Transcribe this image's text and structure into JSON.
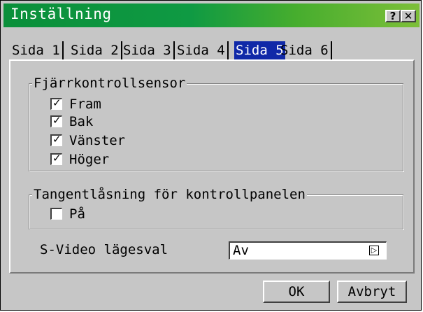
{
  "window": {
    "title": "Inställning",
    "help_label": "?",
    "close_label": "✕"
  },
  "tabs": [
    {
      "label": "Sida 1",
      "active": false
    },
    {
      "label": "Sida 2",
      "active": false
    },
    {
      "label": "Sida 3",
      "active": false
    },
    {
      "label": "Sida 4",
      "active": false
    },
    {
      "label": "Sida 5",
      "active": true
    },
    {
      "label": "Sida 6",
      "active": false
    }
  ],
  "remote_sensor": {
    "legend": "Fjärrkontrollsensor",
    "options": [
      {
        "label": "Fram",
        "checked": true
      },
      {
        "label": "Bak",
        "checked": true
      },
      {
        "label": "Vänster",
        "checked": true
      },
      {
        "label": "Höger",
        "checked": true
      }
    ]
  },
  "key_lock": {
    "legend": "Tangentlåsning för kontrollpanelen",
    "option": {
      "label": "På",
      "checked": false
    }
  },
  "svideo": {
    "label": "S-Video lägesval",
    "value": "Av"
  },
  "buttons": {
    "ok": "OK",
    "cancel": "Avbryt"
  },
  "colors": {
    "title_start": "#0a8f3a",
    "title_end": "#7dbf39",
    "tab_active": "#1029a8",
    "background": "#c6c6c6"
  }
}
